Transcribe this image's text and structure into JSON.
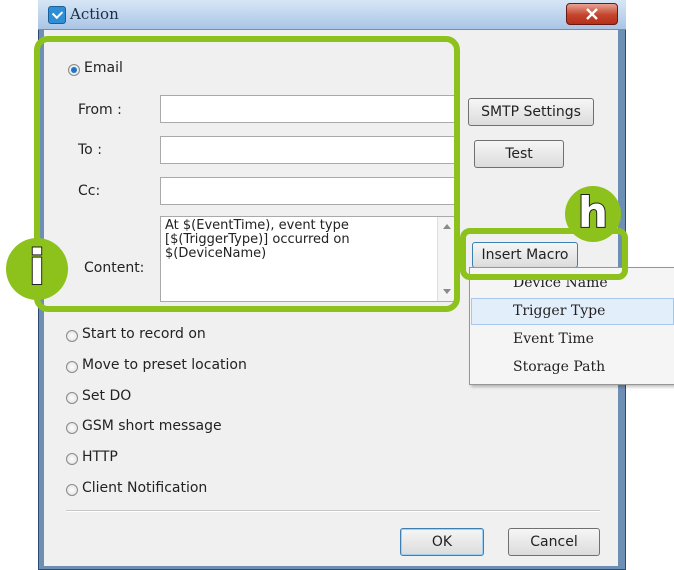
{
  "window": {
    "title": "Action"
  },
  "email": {
    "radio_label": "Email",
    "from_label": "From :",
    "from_value": "",
    "to_label": "To :",
    "to_value": "",
    "cc_label": "Cc:",
    "cc_value": "",
    "content_label": "Content:",
    "content_lines": [
      "At $(EventTime), event type",
      "[$(TriggerType)] occurred on",
      "$(DeviceName)"
    ]
  },
  "buttons": {
    "smtp": "SMTP Settings",
    "test": "Test",
    "insert_macro": "Insert Macro",
    "ok": "OK",
    "cancel": "Cancel"
  },
  "macro_menu": [
    "Device Name",
    "Trigger Type",
    "Event Time",
    "Storage Path"
  ],
  "actions": [
    "Start to record on",
    "Move to preset location",
    "Set DO",
    "GSM short message",
    "HTTP",
    "Client Notification"
  ],
  "callouts": {
    "i_badge": "i",
    "h_badge": "h"
  },
  "colors": {
    "callout_green": "#8cc21b",
    "title_bar": "#c6dbf1",
    "close_red": "#c4442c"
  }
}
